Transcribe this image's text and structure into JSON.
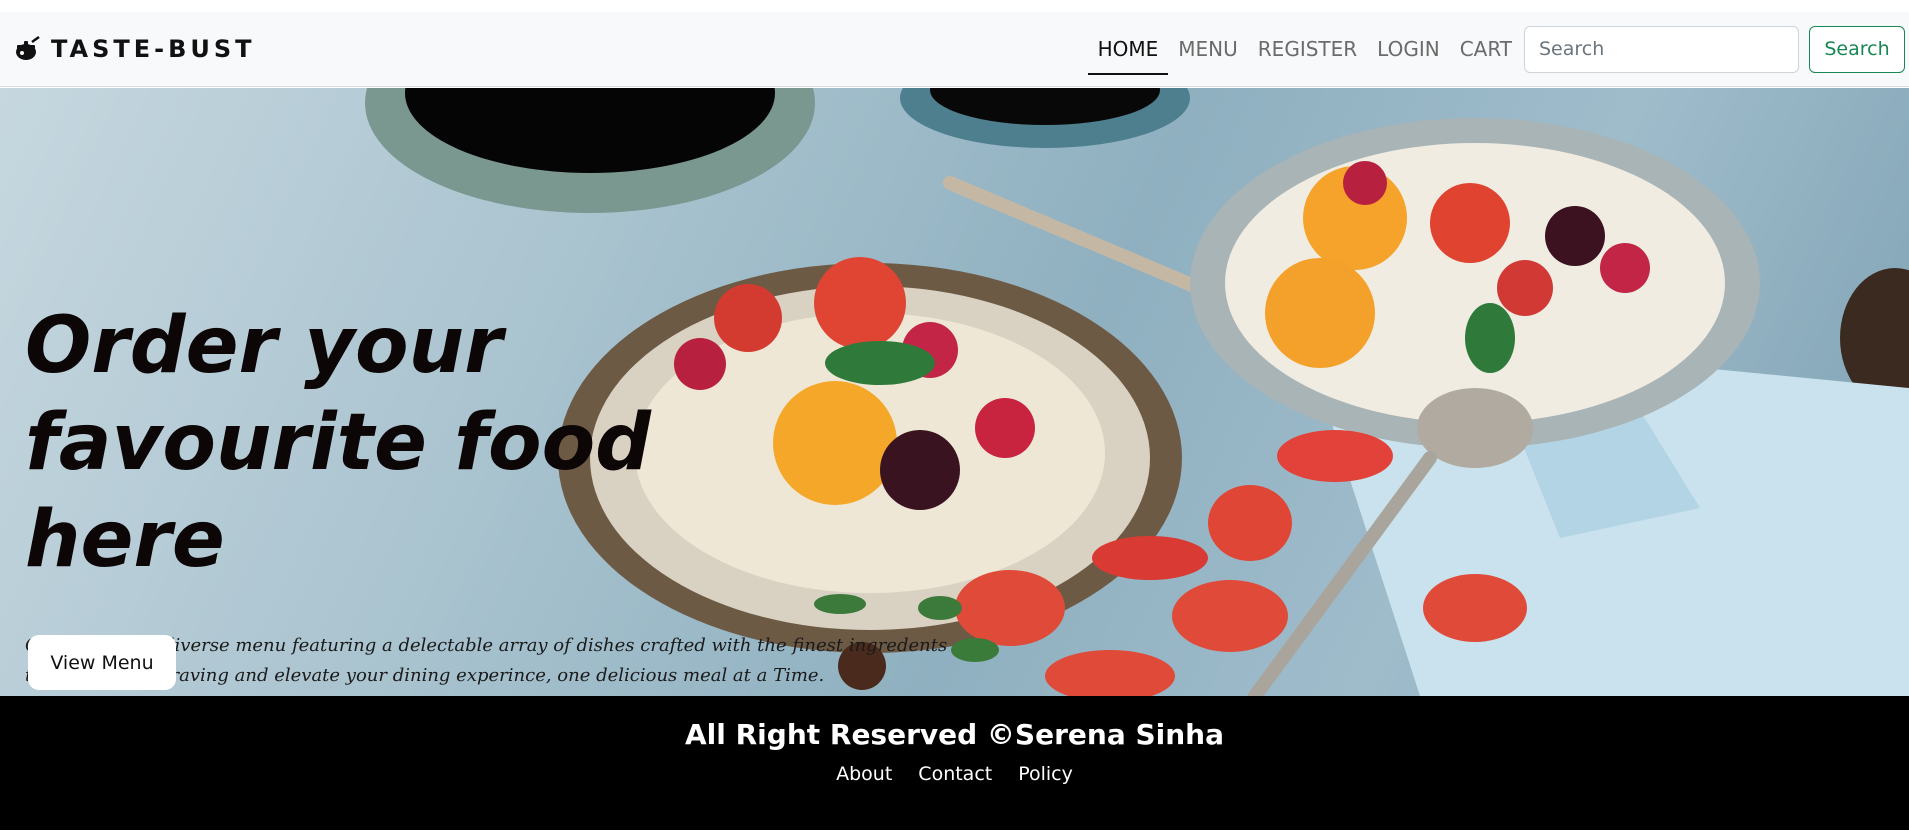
{
  "navbar": {
    "brand": "TASTE-BUST",
    "brand_icon": "cooking-pot-icon",
    "links": [
      {
        "label": "HOME",
        "active": true
      },
      {
        "label": "MENU",
        "active": false
      },
      {
        "label": "REGISTER",
        "active": false
      },
      {
        "label": "LOGIN",
        "active": false
      },
      {
        "label": "CART",
        "active": false
      }
    ],
    "search_placeholder": "Search",
    "search_button": "Search"
  },
  "hero": {
    "title": "Order your favourite food here",
    "description": "Choose from a diverse menu featuring a delectable array of dishes crafted with the finest ingredents to satisfy your craving and elevate your dining experince, one delicious meal at a Time.",
    "button": "View Menu"
  },
  "footer": {
    "text": "All Right Reserved ©Serena Sinha",
    "links": [
      "About",
      "Contact",
      "Policy"
    ]
  },
  "colors": {
    "navbar_bg": "#f8f9fa",
    "search_accent": "#198754",
    "footer_bg": "#000000"
  }
}
